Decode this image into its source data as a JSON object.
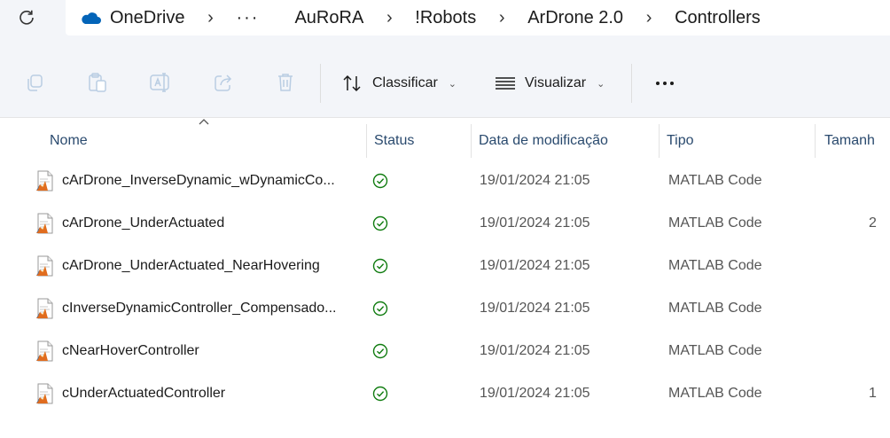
{
  "address_bar": {
    "root": "OneDrive",
    "ellipsis": "···",
    "crumbs": [
      "AuRoRA",
      "!Robots",
      "ArDrone 2.0",
      "Controllers"
    ]
  },
  "toolbar": {
    "copy_icon": "copy-icon",
    "paste_icon": "paste-icon",
    "rename_icon": "rename-icon",
    "share_icon": "share-icon",
    "delete_icon": "delete-icon",
    "sort_label": "Classificar",
    "view_label": "Visualizar"
  },
  "columns": {
    "name": "Nome",
    "status": "Status",
    "date": "Data de modificação",
    "type": "Tipo",
    "size": "Tamanh"
  },
  "files": [
    {
      "name": "cArDrone_InverseDynamic_wDynamicCo...",
      "date": "19/01/2024 21:05",
      "type": "MATLAB Code",
      "size": ""
    },
    {
      "name": "cArDrone_UnderActuated",
      "date": "19/01/2024 21:05",
      "type": "MATLAB Code",
      "size": "2"
    },
    {
      "name": "cArDrone_UnderActuated_NearHovering",
      "date": "19/01/2024 21:05",
      "type": "MATLAB Code",
      "size": ""
    },
    {
      "name": "cInverseDynamicController_Compensado...",
      "date": "19/01/2024 21:05",
      "type": "MATLAB Code",
      "size": ""
    },
    {
      "name": "cNearHoverController",
      "date": "19/01/2024 21:05",
      "type": "MATLAB Code",
      "size": ""
    },
    {
      "name": "cUnderActuatedController",
      "date": "19/01/2024 21:05",
      "type": "MATLAB Code",
      "size": "1"
    }
  ],
  "colors": {
    "onedrive_blue": "#0364b8",
    "status_green": "#107c10",
    "header_text": "#2a4a6e"
  }
}
